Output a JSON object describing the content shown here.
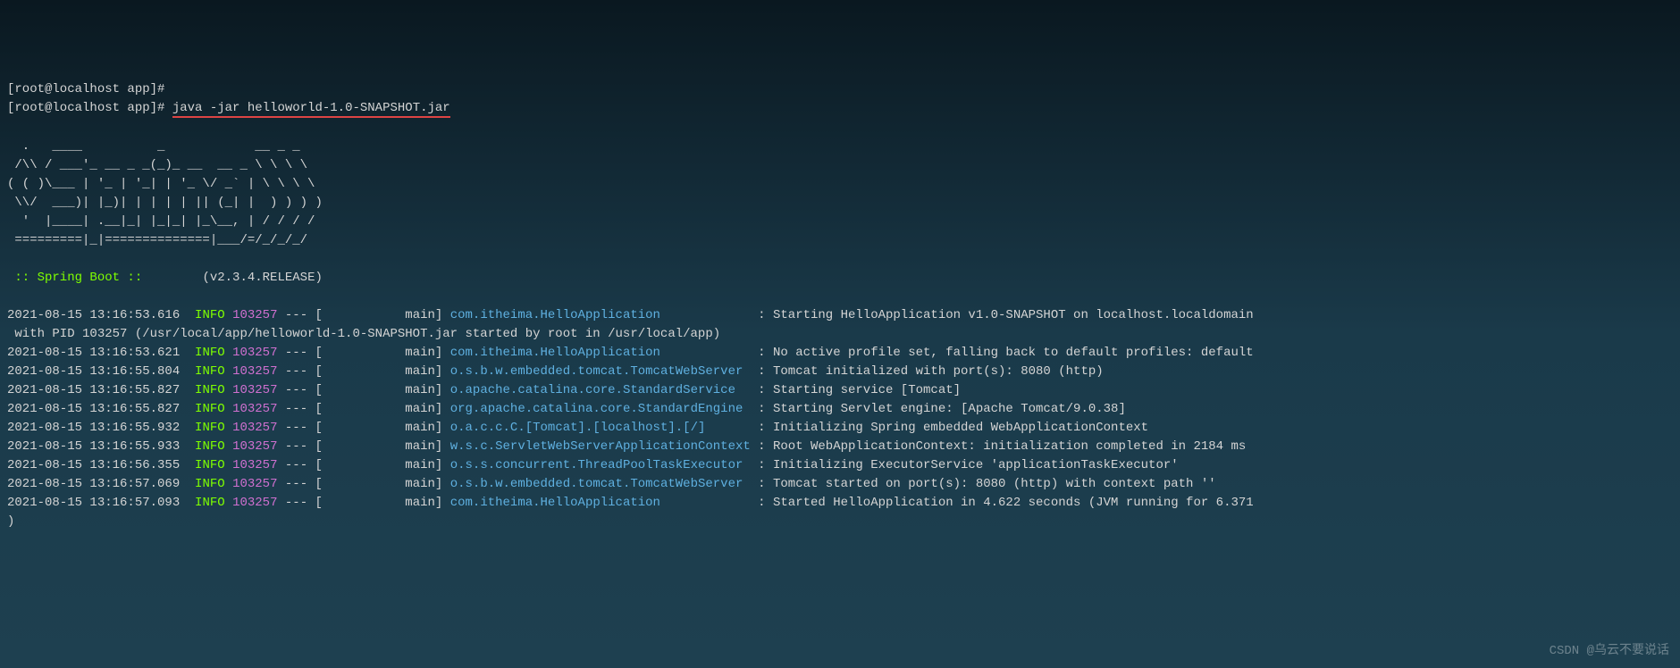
{
  "prompts": [
    {
      "prefix": "[root@localhost app]# ",
      "command": ""
    },
    {
      "prefix": "[root@localhost app]# ",
      "command": "java -jar helloworld-1.0-SNAPSHOT.jar"
    }
  ],
  "ascii_art": "  .   ____          _            __ _ _\n /\\\\ / ___'_ __ _ _(_)_ __  __ _ \\ \\ \\ \\\n( ( )\\___ | '_ | '_| | '_ \\/ _` | \\ \\ \\ \\\n \\\\/  ___)| |_)| | | | | || (_| |  ) ) ) )\n  '  |____| .__|_| |_|_| |_\\__, | / / / /\n =========|_|==============|___/=/_/_/_/",
  "spring_boot_label": " :: Spring Boot ::",
  "spring_boot_version": "        (v2.3.4.RELEASE)",
  "log_lines": [
    {
      "ts": "2021-08-15 13:16:53.616",
      "level": "INFO",
      "pid": "103257",
      "sep": " --- [           main] ",
      "class": "com.itheima.HelloApplication            ",
      "msg": " : Starting HelloApplication v1.0-SNAPSHOT on localhost.localdomain"
    },
    {
      "continuation": " with PID 103257 (/usr/local/app/helloworld-1.0-SNAPSHOT.jar started by root in /usr/local/app)"
    },
    {
      "ts": "2021-08-15 13:16:53.621",
      "level": "INFO",
      "pid": "103257",
      "sep": " --- [           main] ",
      "class": "com.itheima.HelloApplication            ",
      "msg": " : No active profile set, falling back to default profiles: default"
    },
    {
      "ts": "2021-08-15 13:16:55.804",
      "level": "INFO",
      "pid": "103257",
      "sep": " --- [           main] ",
      "class": "o.s.b.w.embedded.tomcat.TomcatWebServer ",
      "msg": " : Tomcat initialized with port(s): 8080 (http)"
    },
    {
      "ts": "2021-08-15 13:16:55.827",
      "level": "INFO",
      "pid": "103257",
      "sep": " --- [           main] ",
      "class": "o.apache.catalina.core.StandardService  ",
      "msg": " : Starting service [Tomcat]"
    },
    {
      "ts": "2021-08-15 13:16:55.827",
      "level": "INFO",
      "pid": "103257",
      "sep": " --- [           main] ",
      "class": "org.apache.catalina.core.StandardEngine ",
      "msg": " : Starting Servlet engine: [Apache Tomcat/9.0.38]"
    },
    {
      "ts": "2021-08-15 13:16:55.932",
      "level": "INFO",
      "pid": "103257",
      "sep": " --- [           main] ",
      "class": "o.a.c.c.C.[Tomcat].[localhost].[/]      ",
      "msg": " : Initializing Spring embedded WebApplicationContext"
    },
    {
      "ts": "2021-08-15 13:16:55.933",
      "level": "INFO",
      "pid": "103257",
      "sep": " --- [           main] ",
      "class": "w.s.c.ServletWebServerApplicationContext",
      "msg": " : Root WebApplicationContext: initialization completed in 2184 ms"
    },
    {
      "ts": "2021-08-15 13:16:56.355",
      "level": "INFO",
      "pid": "103257",
      "sep": " --- [           main] ",
      "class": "o.s.s.concurrent.ThreadPoolTaskExecutor ",
      "msg": " : Initializing ExecutorService 'applicationTaskExecutor'"
    },
    {
      "ts": "2021-08-15 13:16:57.069",
      "level": "INFO",
      "pid": "103257",
      "sep": " --- [           main] ",
      "class": "o.s.b.w.embedded.tomcat.TomcatWebServer ",
      "msg": " : Tomcat started on port(s): 8080 (http) with context path ''"
    },
    {
      "ts": "2021-08-15 13:16:57.093",
      "level": "INFO",
      "pid": "103257",
      "sep": " --- [           main] ",
      "class": "com.itheima.HelloApplication            ",
      "msg": " : Started HelloApplication in 4.622 seconds (JVM running for 6.371"
    },
    {
      "continuation": ")"
    }
  ],
  "watermark": "CSDN @乌云不要说话"
}
